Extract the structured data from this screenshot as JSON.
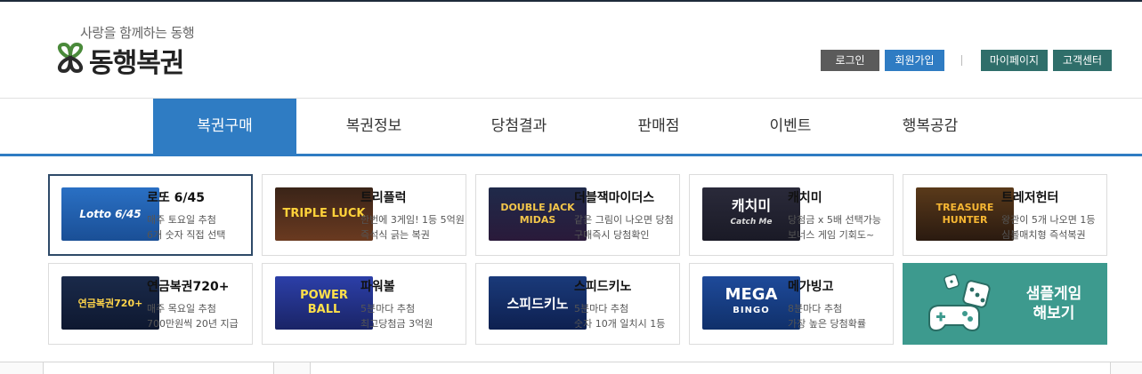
{
  "header": {
    "tagline": "사랑을 함께하는 동행",
    "logo_text": "동행복권",
    "login_label": "로그인",
    "join_label": "회원가입",
    "mypage_label": "마이페이지",
    "cs_label": "고객센터"
  },
  "nav": {
    "items": [
      {
        "label": "복권구매",
        "active": true
      },
      {
        "label": "복권정보",
        "active": false
      },
      {
        "label": "당첨결과",
        "active": false
      },
      {
        "label": "판매점",
        "active": false
      },
      {
        "label": "이벤트",
        "active": false
      },
      {
        "label": "행복공감",
        "active": false
      }
    ]
  },
  "games": [
    {
      "title": "로또 6/45",
      "desc1": "매주 토요일 추첨",
      "desc2": "6개 숫자 직접 선택",
      "thumb_text": "Lotto 6/45",
      "selected": true
    },
    {
      "title": "트리플럭",
      "desc1": "한번에 3게임! 1등 5억원",
      "desc2": "즉석식 긁는 복권",
      "thumb_text": "TRIPLE LUCK",
      "selected": false
    },
    {
      "title": "더블잭마이더스",
      "desc1": "같은 그림이 나오면 당첨",
      "desc2": "구매즉시 당첨확인",
      "thumb_text": "DOUBLE JACK MIDAS",
      "selected": false
    },
    {
      "title": "캐치미",
      "desc1": "당첨금 x 5배 선택가능",
      "desc2": "보너스 게임 기회도~",
      "thumb_text": "캐치미",
      "thumb_subtext": "Catch Me",
      "selected": false
    },
    {
      "title": "트레저헌터",
      "desc1": "왕관이 5개 나오면 1등",
      "desc2": "심볼매치형 즉석복권",
      "thumb_text": "TREASURE HUNTER",
      "selected": false
    },
    {
      "title": "연금복권720+",
      "desc1": "매주 목요일 추첨",
      "desc2": "700만원씩 20년 지급",
      "thumb_text": "연금복권720+",
      "selected": false
    },
    {
      "title": "파워볼",
      "desc1": "5분마다 추첨",
      "desc2": "최고당첨금 3억원",
      "thumb_text": "POWER BALL",
      "selected": false
    },
    {
      "title": "스피드키노",
      "desc1": "5분마다 추첨",
      "desc2": "숫자 10개 일치시 1등",
      "thumb_text": "스피드키노",
      "selected": false
    },
    {
      "title": "메가빙고",
      "desc1": "8분마다 추첨",
      "desc2": "가장 높은 당첨확률",
      "thumb_text": "MEGA",
      "thumb_subtext": "BINGO",
      "selected": false
    }
  ],
  "sample": {
    "line1": "샘플게임",
    "line2": "해보기"
  },
  "colors": {
    "primary_blue": "#2f7cc3",
    "teal": "#3d9a8e",
    "dark_teal_button": "#2f6e6a",
    "gray_button": "#5b5b5b",
    "selected_border": "#2e4a68"
  }
}
